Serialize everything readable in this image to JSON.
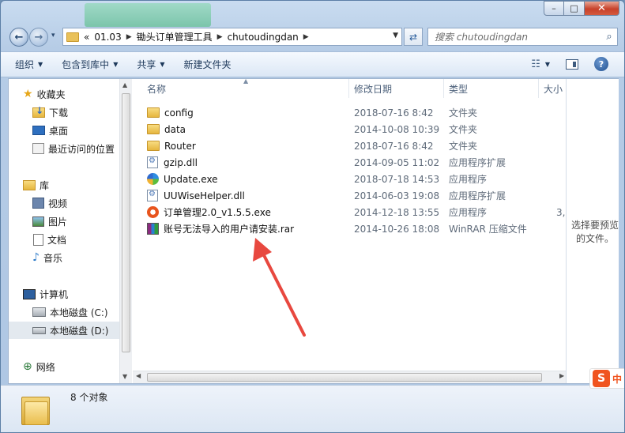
{
  "window": {
    "minimize_glyph": "–",
    "maximize_glyph": "□",
    "close_glyph": "✕"
  },
  "nav": {
    "back_glyph": "←",
    "forward_glyph": "→",
    "address": {
      "prefix": "«",
      "parts": [
        "01.03",
        "锄头订单管理工具",
        "chutoudingdan"
      ]
    },
    "search_placeholder": "搜索 chutoudingdan"
  },
  "toolbar": {
    "organize": "组织",
    "include_in_library": "包含到库中",
    "share": "共享",
    "new_folder": "新建文件夹"
  },
  "sidebar": {
    "favorites": "收藏夹",
    "downloads": "下载",
    "desktop": "桌面",
    "recent": "最近访问的位置",
    "libraries": "库",
    "videos": "视频",
    "pictures": "图片",
    "documents": "文档",
    "music": "音乐",
    "computer": "计算机",
    "drive_c": "本地磁盘 (C:)",
    "drive_d": "本地磁盘 (D:)",
    "network": "网络"
  },
  "columns": {
    "name": "名称",
    "date": "修改日期",
    "type": "类型",
    "size": "大小"
  },
  "files": [
    {
      "name": "config",
      "date": "2018-07-16 8:42",
      "type": "文件夹",
      "size": "",
      "icon": "folder-icon"
    },
    {
      "name": "data",
      "date": "2014-10-08 10:39",
      "type": "文件夹",
      "size": "",
      "icon": "folder-icon"
    },
    {
      "name": "Router",
      "date": "2018-07-16 8:42",
      "type": "文件夹",
      "size": "",
      "icon": "folder-icon"
    },
    {
      "name": "gzip.dll",
      "date": "2014-09-05 11:02",
      "type": "应用程序扩展",
      "size": "",
      "icon": "dll-icon"
    },
    {
      "name": "Update.exe",
      "date": "2018-07-18 14:53",
      "type": "应用程序",
      "size": "",
      "icon": "uu-exe-icon"
    },
    {
      "name": "UUWiseHelper.dll",
      "date": "2014-06-03 19:08",
      "type": "应用程序扩展",
      "size": "",
      "icon": "dll-icon"
    },
    {
      "name": "订单管理2.0_v1.5.5.exe",
      "date": "2014-12-18 13:55",
      "type": "应用程序",
      "size": "3,",
      "icon": "order-exe-icon"
    },
    {
      "name": "账号无法导入的用户请安装.rar",
      "date": "2014-10-26 18:08",
      "type": "WinRAR 压缩文件",
      "size": "",
      "icon": "rar-icon"
    }
  ],
  "preview": {
    "text": "选择要预览的文件。"
  },
  "details": {
    "count": "8 个对象"
  },
  "ime": {
    "logo": "S",
    "label": "中"
  },
  "colors": {
    "annotation_arrow": "#e8483f",
    "accent_blue": "#2a5d9c"
  }
}
